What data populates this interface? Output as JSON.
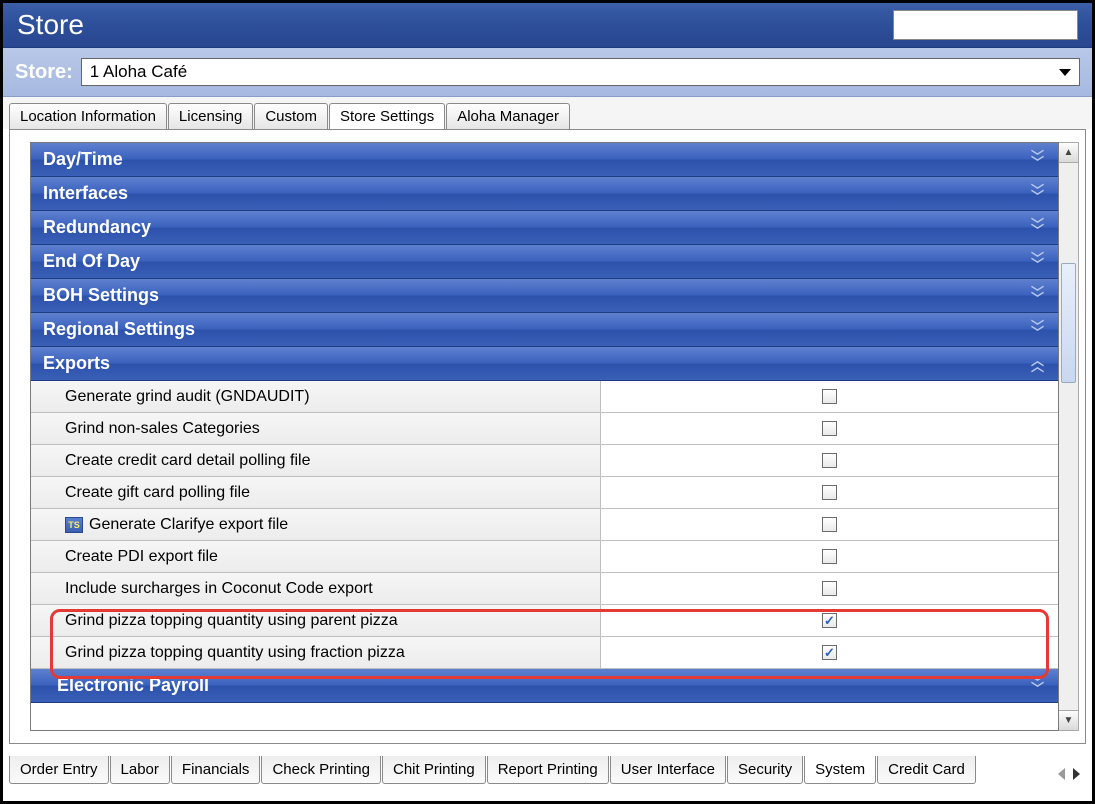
{
  "title": "Store",
  "store": {
    "label": "Store:",
    "value": "1 Aloha Café"
  },
  "topTabs": [
    "Location Information",
    "Licensing",
    "Custom",
    "Store Settings",
    "Aloha Manager"
  ],
  "topTabActive": 3,
  "sections": {
    "collapsed": [
      "Day/Time",
      "Interfaces",
      "Redundancy",
      "End Of Day",
      "BOH Settings",
      "Regional Settings"
    ],
    "expanded": "Exports",
    "after": "Electronic Payroll"
  },
  "exportRows": [
    {
      "label": "Generate grind audit (GNDAUDIT)",
      "checked": false,
      "icon": null
    },
    {
      "label": "Grind non-sales Categories",
      "checked": false,
      "icon": null
    },
    {
      "label": "Create credit card detail polling file",
      "checked": false,
      "icon": null
    },
    {
      "label": "Create gift card polling file",
      "checked": false,
      "icon": null
    },
    {
      "label": "Generate Clarifye export file",
      "checked": false,
      "icon": "TS"
    },
    {
      "label": "Create PDI export file",
      "checked": false,
      "icon": null
    },
    {
      "label": "Include surcharges in Coconut Code export",
      "checked": false,
      "icon": null
    },
    {
      "label": "Grind pizza topping quantity using parent pizza",
      "checked": true,
      "icon": null
    },
    {
      "label": "Grind pizza topping quantity using fraction pizza",
      "checked": true,
      "icon": null
    }
  ],
  "bottomTabs": [
    "Order Entry",
    "Labor",
    "Financials",
    "Check Printing",
    "Chit Printing",
    "Report Printing",
    "User Interface",
    "Security",
    "System",
    "Credit Card"
  ],
  "bottomTabActive": 8
}
